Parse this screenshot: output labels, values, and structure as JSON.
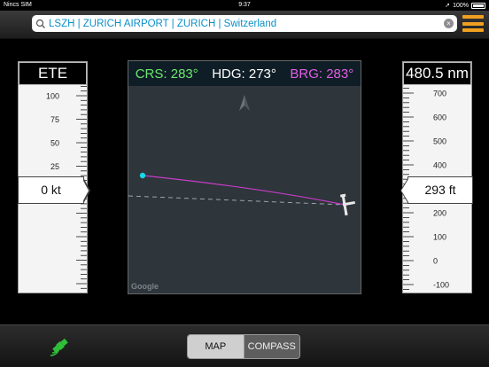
{
  "status": {
    "carrier": "Nincs SIM",
    "time": "9:37",
    "battery": "100%"
  },
  "search": {
    "value": "LSZH | ZURICH AIRPORT | ZURICH | Switzerland",
    "clear_glyph": "×"
  },
  "left_gauge": {
    "title": "ETE",
    "ticks": [
      "100",
      "75",
      "50",
      "25"
    ],
    "readout": "0 kt"
  },
  "right_gauge": {
    "title": "480.5 nm",
    "ticks": [
      "700",
      "600",
      "500",
      "400",
      "300",
      "200",
      "100",
      "0",
      "-100"
    ],
    "readout": "293 ft"
  },
  "map": {
    "crs": "CRS: 283°",
    "hdg": "HDG: 273°",
    "brg": "BRG: 283°",
    "attribution": "Google",
    "colors": {
      "crs": "#6ee86e",
      "hdg": "#ffffff",
      "brg": "#e45de4",
      "waypoint": "#19d6e6"
    }
  },
  "tabs": {
    "map": "MAP",
    "compass": "COMPASS",
    "selected": "MAP"
  },
  "icons": {
    "search": "magnifier-icon",
    "menu": "hamburger-menu-icon",
    "north": "north-arrow-icon",
    "plane": "airplane-icon",
    "gps": "satellite-icon"
  }
}
